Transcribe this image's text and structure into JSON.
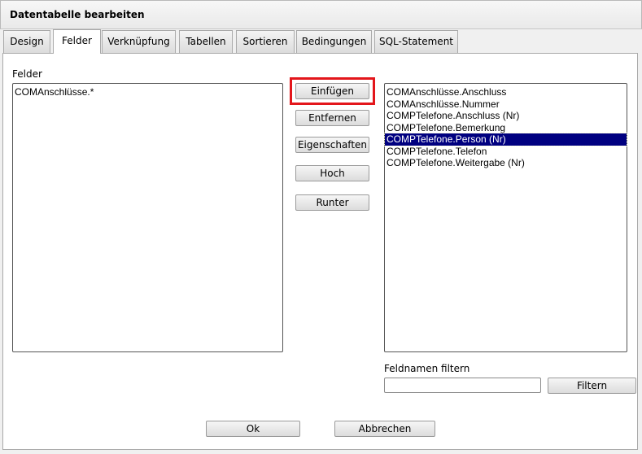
{
  "window": {
    "title": "Datentabelle bearbeiten"
  },
  "tabs": [
    {
      "label": "Design"
    },
    {
      "label": "Felder"
    },
    {
      "label": "Verknüpfung"
    },
    {
      "label": "Tabellen"
    },
    {
      "label": "Sortieren"
    },
    {
      "label": "Bedingungen"
    },
    {
      "label": "SQL-Statement"
    }
  ],
  "active_tab": "Felder",
  "felder": {
    "label": "Felder",
    "items": [
      "COMAnschlüsse.*"
    ]
  },
  "buttons": {
    "einfuegen": "Einfügen",
    "entfernen": "Entfernen",
    "eigenschaften": "Eigenschaften",
    "hoch": "Hoch",
    "runter": "Runter"
  },
  "available": {
    "items": [
      "COMAnschlüsse.Anschluss",
      "COMAnschlüsse.Nummer",
      "COMPTelefone.Anschluss (Nr)",
      "COMPTelefone.Bemerkung",
      "COMPTelefone.Person (Nr)",
      "COMPTelefone.Telefon",
      "COMPTelefone.Weitergabe (Nr)"
    ],
    "selected": "COMPTelefone.Person (Nr)"
  },
  "filter": {
    "label": "Feldnamen filtern",
    "value": "",
    "button": "Filtern"
  },
  "footer": {
    "ok": "Ok",
    "cancel": "Abbrechen"
  },
  "colors": {
    "selection": "#000080",
    "highlight": "#e3161b"
  }
}
